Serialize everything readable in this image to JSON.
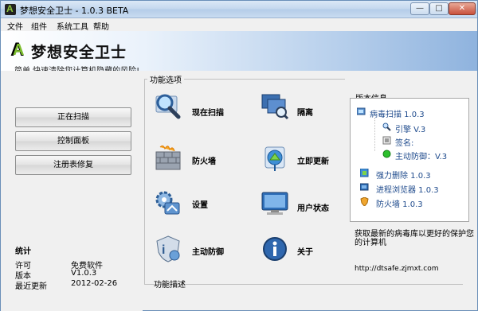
{
  "window": {
    "title": "梦想安全卫士 - 1.0.3  BETA",
    "min": "—",
    "max": "□",
    "close": "✕"
  },
  "menu": [
    "文件",
    "组件",
    "系统工具",
    "帮助"
  ],
  "header": {
    "app_name": "梦想安全卫士",
    "slogan": "简单,快速清除您计算机隐藏的风险!"
  },
  "left": {
    "buttons": [
      "正在扫描",
      "控制面板",
      "注册表修复"
    ],
    "stats_title": "统计",
    "stats": [
      {
        "k": "许可",
        "v": "免费软件"
      },
      {
        "k": "版本",
        "v": "V1.0.3"
      },
      {
        "k": "最近更新",
        "v": "2012-02-26"
      }
    ]
  },
  "features": {
    "section_label": "功能选项",
    "items": [
      "现在扫描",
      "隔离",
      "防火墙",
      "立即更新",
      "设置",
      "用户状态",
      "主动防御",
      "关于"
    ],
    "icons": [
      "scan-magnifier-icon",
      "quarantine-monitor-icon",
      "firewall-wall-icon",
      "update-globe-icon",
      "settings-gear-icon",
      "user-monitor-icon",
      "proactive-shield-icon",
      "about-info-icon"
    ]
  },
  "info": {
    "section_label": "版本信息",
    "virus_scan": "病毒扫描 1.0.3",
    "engine": "引擎 V.3",
    "signature": "签名:",
    "proactive": "主动防御：V.3",
    "force_delete": "强力删除  1.0.3",
    "process_browser": "进程浏览器 1.0.3",
    "firewall": "防火墙 1.0.3"
  },
  "description": {
    "text": "获取最新的病毒库以更好的保护您的计算机",
    "link": "http://dtsafe.zjmxt.com"
  },
  "footer": {
    "label": "功能描述"
  },
  "colors": {
    "accent": "#1e4a8c",
    "header_blue": "#8fb3de",
    "logo_green": "#7cbd2e"
  }
}
